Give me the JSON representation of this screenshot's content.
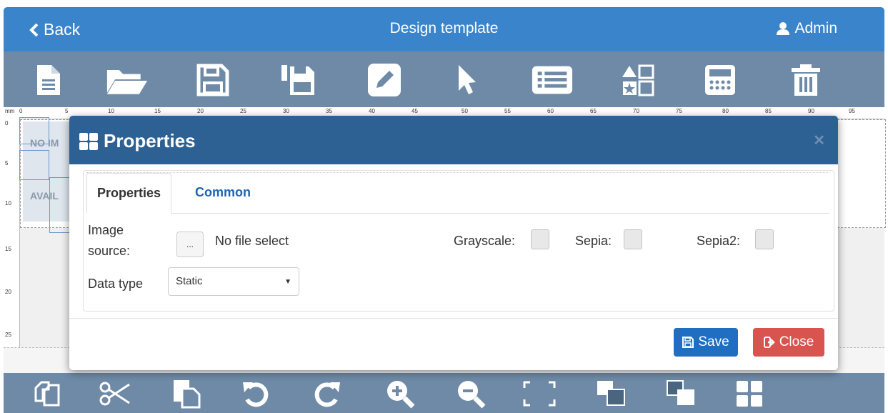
{
  "header": {
    "back_label": "Back",
    "title": "Design template",
    "user_label": "Admin"
  },
  "toolbar_top": [
    "new-file-icon",
    "open-folder-icon",
    "save-icon",
    "save-as-icon",
    "edit-icon",
    "pointer-icon",
    "list-icon",
    "shapes-icon",
    "calculator-icon",
    "trash-icon"
  ],
  "toolbar_bottom": [
    "copy-icon",
    "cut-icon",
    "paste-icon",
    "undo-icon",
    "redo-icon",
    "zoom-in-icon",
    "zoom-out-icon",
    "fit-icon",
    "bring-front-icon",
    "send-back-icon",
    "grid-icon"
  ],
  "ruler": {
    "unit": "mm",
    "h_ticks": [
      "0",
      "5",
      "10",
      "15",
      "20",
      "25",
      "30",
      "35",
      "40",
      "45",
      "50",
      "55",
      "60",
      "65",
      "70",
      "75",
      "80",
      "85",
      "90",
      "95"
    ],
    "v_ticks": [
      "0",
      "5",
      "10",
      "15",
      "20",
      "25"
    ]
  },
  "canvas": {
    "placeholder_line1": "NO IM",
    "placeholder_line2": "AVAIL"
  },
  "modal": {
    "title": "Properties",
    "tabs": [
      {
        "label": "Properties",
        "active": true
      },
      {
        "label": "Common",
        "active": false
      }
    ],
    "image_source_label_1": "Image",
    "image_source_label_2": "source:",
    "file_button_label": "...",
    "file_status": "No file select",
    "grayscale_label": "Grayscale:",
    "sepia_label": "Sepia:",
    "sepia2_label": "Sepia2:",
    "data_type_label": "Data type",
    "data_type_value": "Static",
    "save_label": "Save",
    "close_label": "Close",
    "colors": {
      "header": "#2e6193",
      "save": "#1f6ec2",
      "close": "#d9534f"
    }
  }
}
